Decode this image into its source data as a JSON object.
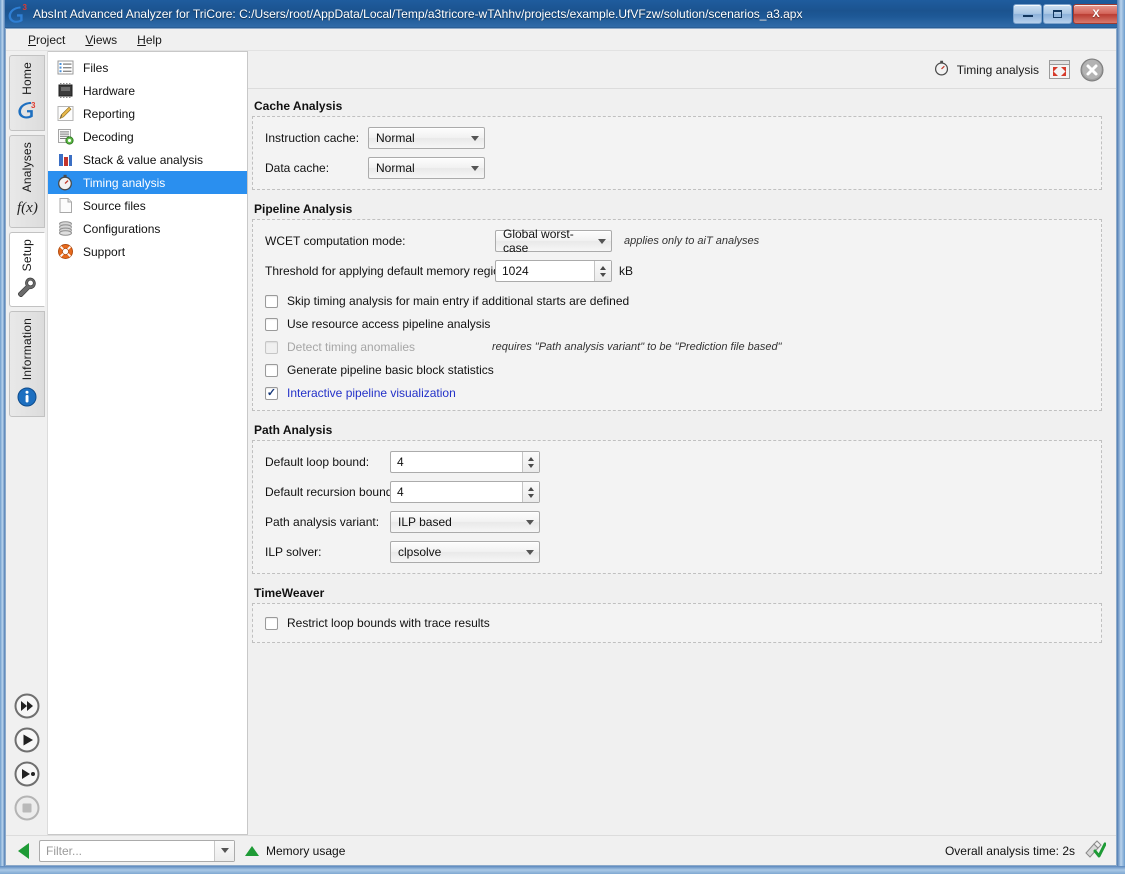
{
  "window": {
    "title": "AbsInt Advanced Analyzer for TriCore: C:/Users/root/AppData/Local/Temp/a3tricore-wTAhhv/projects/example.UfVFzw/solution/scenarios_a3.apx",
    "app_badge": "a",
    "app_badge_sup": "3",
    "minimize_label": "Minimize",
    "maximize_label": "Maximize",
    "close_label": "X"
  },
  "menubar": {
    "items": [
      {
        "label": "Project",
        "accel": "P"
      },
      {
        "label": "Views",
        "accel": "V"
      },
      {
        "label": "Help",
        "accel": "H"
      }
    ]
  },
  "rail": {
    "tabs": [
      {
        "label": "Home",
        "icon": "a3-logo-icon",
        "active": false
      },
      {
        "label": "Analyses",
        "icon": "fx-icon",
        "active": false
      },
      {
        "label": "Setup",
        "icon": "wrench-icon",
        "active": true
      },
      {
        "label": "Information",
        "icon": "info-icon",
        "active": false
      }
    ],
    "buttons": [
      {
        "name": "run-all-button",
        "icon": "fast-forward-icon",
        "enabled": true
      },
      {
        "name": "run-button",
        "icon": "play-icon",
        "enabled": true
      },
      {
        "name": "run-step-button",
        "icon": "play-to-icon",
        "enabled": true
      },
      {
        "name": "stop-button",
        "icon": "stop-icon",
        "enabled": false
      }
    ]
  },
  "tree": {
    "items": [
      {
        "label": "Files",
        "icon": "files-icon",
        "selected": false
      },
      {
        "label": "Hardware",
        "icon": "hardware-chip-icon",
        "selected": false
      },
      {
        "label": "Reporting",
        "icon": "pencil-icon",
        "selected": false
      },
      {
        "label": "Decoding",
        "icon": "decoding-icon",
        "selected": false
      },
      {
        "label": "Stack & value analysis",
        "icon": "bar-chart-icon",
        "selected": false
      },
      {
        "label": "Timing analysis",
        "icon": "stopwatch-icon",
        "selected": true
      },
      {
        "label": "Source files",
        "icon": "document-icon",
        "selected": false
      },
      {
        "label": "Configurations",
        "icon": "database-icon",
        "selected": false
      },
      {
        "label": "Support",
        "icon": "lifebuoy-icon",
        "selected": false
      }
    ]
  },
  "content_header": {
    "title": "Timing analysis",
    "title_icon": "stopwatch-icon",
    "expand_icon": "expand-window-icon",
    "close_icon": "close-circle-icon"
  },
  "sections": {
    "cache_analysis": {
      "title": "Cache Analysis",
      "fields": [
        {
          "label": "Instruction cache:",
          "value": "Normal",
          "name": "instruction-cache-select"
        },
        {
          "label": "Data cache:",
          "value": "Normal",
          "name": "data-cache-select"
        }
      ]
    },
    "pipeline_analysis": {
      "title": "Pipeline Analysis",
      "wcet_label": "WCET computation mode:",
      "wcet_value": "Global worst-case",
      "wcet_hint": "applies only to aiT analyses",
      "threshold_label": "Threshold for applying default memory regions:",
      "threshold_value": "1024",
      "threshold_unit": "kB",
      "checkboxes": [
        {
          "label": "Skip timing analysis for main entry if additional starts are defined",
          "checked": false,
          "disabled": false,
          "hint": "",
          "name": "skip-timing-analysis-checkbox"
        },
        {
          "label": "Use resource access pipeline analysis",
          "checked": false,
          "disabled": false,
          "hint": "",
          "name": "use-resource-access-checkbox"
        },
        {
          "label": "Detect timing anomalies",
          "checked": false,
          "disabled": true,
          "hint": "requires \"Path analysis variant\" to be \"Prediction file based\"",
          "name": "detect-timing-anomalies-checkbox"
        },
        {
          "label": "Generate pipeline basic block statistics",
          "checked": false,
          "disabled": false,
          "hint": "",
          "name": "generate-pipeline-statistics-checkbox"
        },
        {
          "label": "Interactive pipeline visualization",
          "checked": true,
          "disabled": false,
          "hint": "",
          "name": "interactive-pipeline-visualization-checkbox"
        }
      ]
    },
    "path_analysis": {
      "title": "Path Analysis",
      "fields": [
        {
          "label": "Default loop bound:",
          "value": "4",
          "type": "spinner",
          "name": "default-loop-bound-spinner"
        },
        {
          "label": "Default recursion bound:",
          "value": "4",
          "type": "spinner",
          "name": "default-recursion-bound-spinner"
        },
        {
          "label": "Path analysis variant:",
          "value": "ILP based",
          "type": "combo",
          "name": "path-analysis-variant-select"
        },
        {
          "label": "ILP solver:",
          "value": "clpsolve",
          "type": "combo",
          "name": "ilp-solver-select"
        }
      ]
    },
    "timeweaver": {
      "title": "TimeWeaver",
      "checkboxes": [
        {
          "label": "Restrict loop bounds with trace results",
          "checked": false,
          "disabled": false,
          "name": "restrict-loop-bounds-checkbox"
        }
      ]
    }
  },
  "statusbar": {
    "filter_placeholder": "Filter...",
    "filter_value": "",
    "memory_usage_label": "Memory usage",
    "analysis_time_label": "Overall analysis time: 2s"
  },
  "colors": {
    "selection_blue": "#2a8fef",
    "link_blue": "#2331c8",
    "green": "#1e9b36",
    "title_blue": "#1b538f"
  }
}
